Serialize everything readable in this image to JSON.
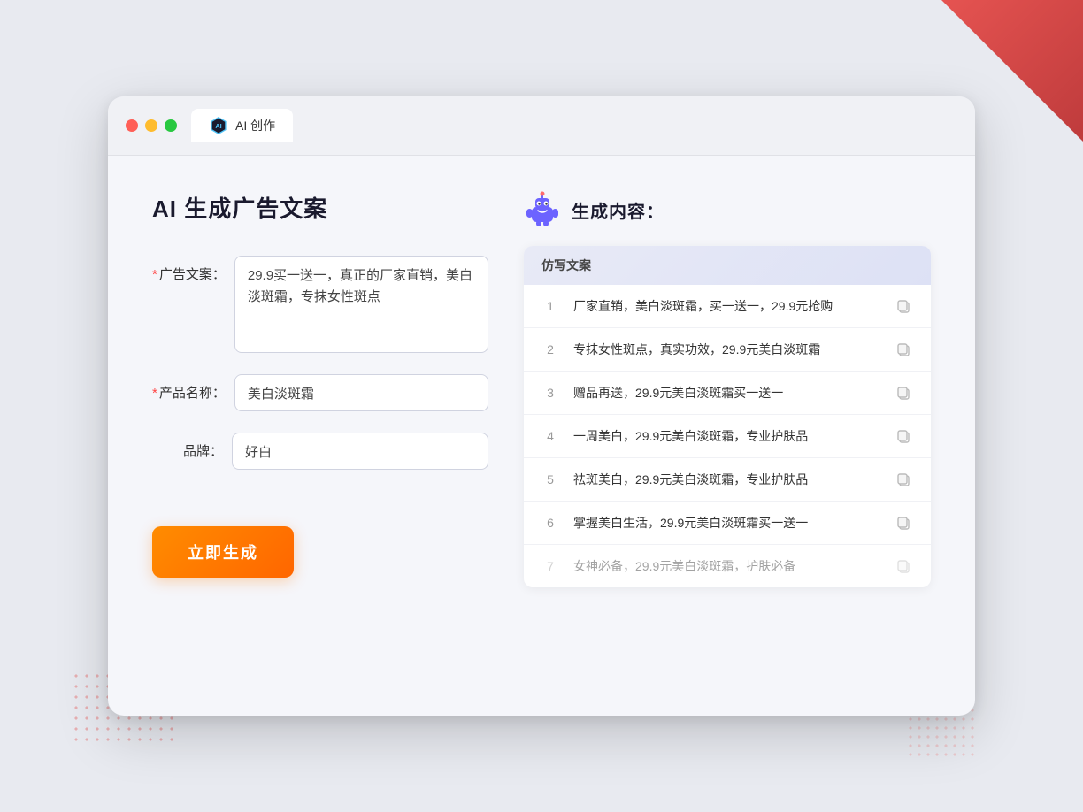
{
  "browser": {
    "tab_label": "AI 创作"
  },
  "page": {
    "title": "AI 生成广告文案",
    "result_header": "生成内容："
  },
  "form": {
    "ad_copy_label": "广告文案：",
    "ad_copy_required": true,
    "ad_copy_value": "29.9买一送一，真正的厂家直销，美白淡斑霜，专抹女性斑点",
    "product_name_label": "产品名称：",
    "product_name_required": true,
    "product_name_value": "美白淡斑霜",
    "brand_label": "品牌：",
    "brand_required": false,
    "brand_value": "好白",
    "generate_button_label": "立即生成"
  },
  "results": {
    "column_header": "仿写文案",
    "items": [
      {
        "num": "1",
        "text": "厂家直销，美白淡斑霜，买一送一，29.9元抢购",
        "dimmed": false
      },
      {
        "num": "2",
        "text": "专抹女性斑点，真实功效，29.9元美白淡斑霜",
        "dimmed": false
      },
      {
        "num": "3",
        "text": "赠品再送，29.9元美白淡斑霜买一送一",
        "dimmed": false
      },
      {
        "num": "4",
        "text": "一周美白，29.9元美白淡斑霜，专业护肤品",
        "dimmed": false
      },
      {
        "num": "5",
        "text": "祛斑美白，29.9元美白淡斑霜，专业护肤品",
        "dimmed": false
      },
      {
        "num": "6",
        "text": "掌握美白生活，29.9元美白淡斑霜买一送一",
        "dimmed": false
      },
      {
        "num": "7",
        "text": "女神必备，29.9元美白淡斑霜，护肤必备",
        "dimmed": true
      }
    ]
  }
}
